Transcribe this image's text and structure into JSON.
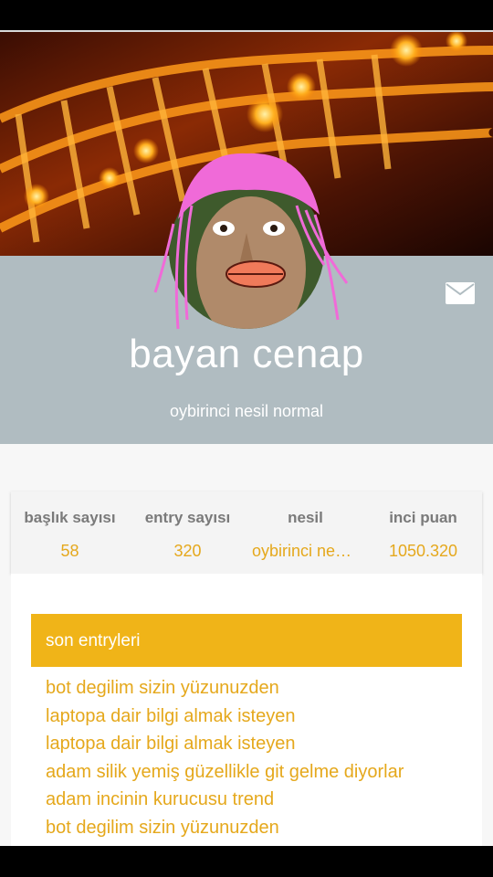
{
  "profile": {
    "name": "bayan cenap",
    "subtitle": "oybirinci nesil normal"
  },
  "header_actions": {
    "message_icon": "envelope-icon"
  },
  "stats": [
    {
      "label": "başlık sayısı",
      "value": "58"
    },
    {
      "label": "entry sayısı",
      "value": "320"
    },
    {
      "label": "nesil",
      "value": "oybirinci nesil normal"
    },
    {
      "label": "inci puan",
      "value": "1050.320"
    }
  ],
  "recent": {
    "title": "son entryleri",
    "entries": [
      "bot degilim sizin yüzunuzden",
      "laptopa dair bilgi almak isteyen",
      "laptopa dair bilgi almak isteyen",
      "adam silik yemiş güzellikle git gelme diyorlar",
      "adam incinin kurucusu trend",
      "bot degilim sizin yüzunuzden"
    ]
  },
  "colors": {
    "accent": "#f0b418",
    "accent_text": "#e5a81c",
    "band": "#b0bcc1"
  }
}
